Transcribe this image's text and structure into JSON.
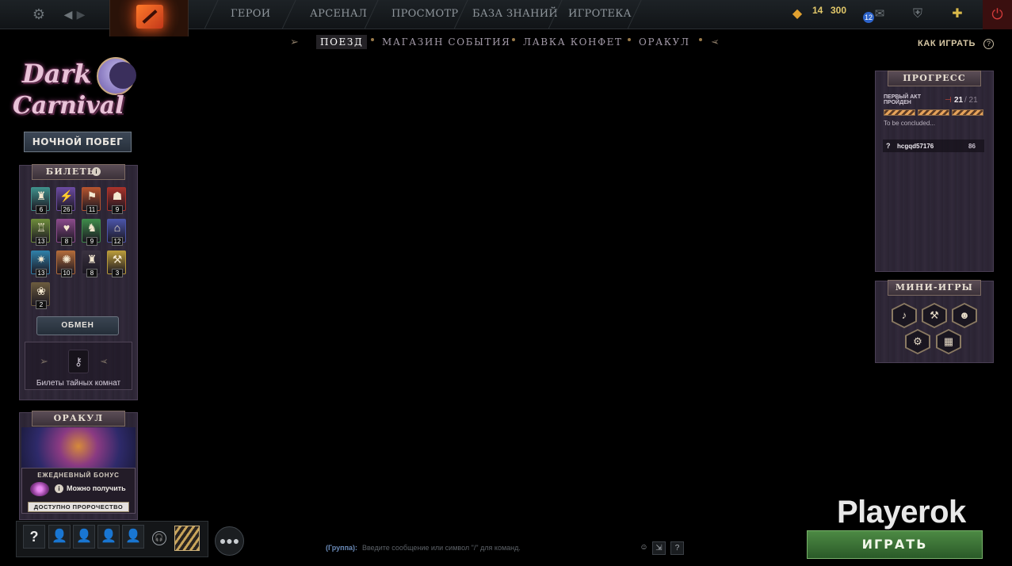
{
  "topnav": {
    "items": [
      "ГЕРОИ",
      "АРСЕНАЛ",
      "ПРОСМОТР",
      "БАЗА ЗНАНИЙ",
      "ИГРОТЕКА"
    ],
    "currency_a": "14",
    "currency_b": "300",
    "notifications": "12"
  },
  "event_nav": {
    "tabs": [
      "ПОЕЗД",
      "МАГАЗИН СОБЫТИЯ",
      "ЛАВКА КОНФЕТ",
      "ОРАКУЛ"
    ],
    "active": "ПОЕЗД",
    "how_to_play": "КАК ИГРАТЬ"
  },
  "event_logo": {
    "line1": "Dark",
    "line2": "Carnival",
    "subtitle": "НОЧНОЙ ПОБЕГ"
  },
  "tickets": {
    "title": "БИЛЕТЫ",
    "items": [
      {
        "icon": "tower-ticket-icon",
        "glyph": "♜",
        "color": "#3f8f8a",
        "count": "6"
      },
      {
        "icon": "lightning-ticket-icon",
        "glyph": "⚡",
        "color": "#6a4aa0",
        "count": "26"
      },
      {
        "icon": "banner-ticket-icon",
        "glyph": "⚑",
        "color": "#b4532e",
        "count": "11"
      },
      {
        "icon": "mask-ticket-icon",
        "glyph": "☗",
        "color": "#a8322a",
        "count": "9"
      },
      {
        "icon": "robot-ticket-icon",
        "glyph": "♖",
        "color": "#6c8a3a",
        "count": "13"
      },
      {
        "icon": "heart-ticket-icon",
        "glyph": "♥",
        "color": "#8a4a8a",
        "count": "8"
      },
      {
        "icon": "boot-ticket-icon",
        "glyph": "♞",
        "color": "#3e8a4a",
        "count": "9"
      },
      {
        "icon": "castle-ticket-icon",
        "glyph": "⌂",
        "color": "#4a54a8",
        "count": "12"
      },
      {
        "icon": "star-ticket-icon",
        "glyph": "✷",
        "color": "#2f7ea6",
        "count": "13"
      },
      {
        "icon": "shield-ticket-icon",
        "glyph": "✺",
        "color": "#b06a3a",
        "count": "10"
      },
      {
        "icon": "lantern-ticket-icon",
        "glyph": "♜",
        "color": "#3a3240",
        "count": "8"
      },
      {
        "icon": "hammer-ticket-icon",
        "glyph": "⚒",
        "color": "#b89a3a",
        "count": "3"
      },
      {
        "icon": "flowers-ticket-icon",
        "glyph": "❀",
        "color": "#6a5a3e",
        "count": "2"
      }
    ],
    "exchange_button": "ОБМЕН",
    "secret_rooms_label": "Билеты тайных комнат"
  },
  "oracle": {
    "title": "ОРАКУЛ",
    "daily_bonus_title": "ЕЖЕДНЕВНЫЙ БОНУС",
    "can_get": "Можно получить",
    "prophecy_button": "ДОСТУПНО ПРОРОЧЕСТВО"
  },
  "party": {
    "help": "?"
  },
  "chat": {
    "group_label": "(Группа):",
    "placeholder": "Введите сообщение или символ \"/\" для команд."
  },
  "progress": {
    "title": "ПРОГРЕСС",
    "act_label": "ПЕРВЫЙ АКТ ПРОЙДЕН",
    "count": "21",
    "total": "/ 21",
    "status": "To be concluded...",
    "player": {
      "rank": "?",
      "name": "hcgqd57176",
      "score": "86"
    }
  },
  "mini_games": {
    "title": "МИНИ-ИГРЫ",
    "items": [
      {
        "icon": "guitar-icon",
        "glyph": "♪"
      },
      {
        "icon": "hammer-game-icon",
        "glyph": "⚒"
      },
      {
        "icon": "skull-game-icon",
        "glyph": "☻"
      },
      {
        "icon": "gear-game-icon",
        "glyph": "⚙"
      },
      {
        "icon": "cage-game-icon",
        "glyph": "▦"
      }
    ]
  },
  "watermark": "Playerok",
  "play_button": "ИГРАТЬ"
}
